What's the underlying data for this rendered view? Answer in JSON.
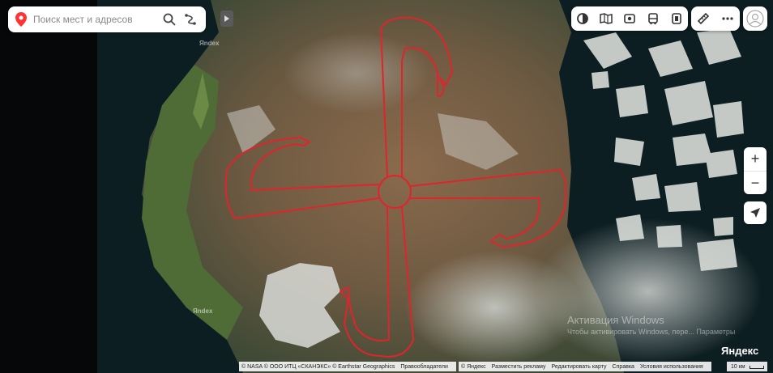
{
  "search": {
    "placeholder": "Поиск мест и адресов"
  },
  "icons": {
    "pin": "location-pin-icon",
    "search": "search-icon",
    "route": "route-icon",
    "collapse": "triangle-right-icon",
    "layers": "layers-icon",
    "panorama": "panorama-icon",
    "metro": "metro-icon",
    "transit": "bus-icon",
    "traffic": "traffic-icon",
    "ruler": "ruler-icon",
    "more": "more-icon",
    "user": "user-icon",
    "zoom_in": "plus-icon",
    "zoom_out": "minus-icon",
    "geolocation": "arrow-icon"
  },
  "map": {
    "watermarks": [
      "Яndex",
      "Яndex"
    ],
    "brand": "Яндекс",
    "overlay_text": [
      "Активация Windows",
      "Чтобы активировать Windows, пере... Параметры"
    ]
  },
  "zoom": {
    "in_label": "+",
    "out_label": "−"
  },
  "footer": {
    "left": [
      "© NASA © ООО ИТЦ «СКАНЭКС» © Earthstar Geographics",
      "Правообладатели"
    ],
    "right": [
      "© Яндекс",
      "Разместить рекламу",
      "Редактировать карту",
      "Справка",
      "Условия использования"
    ],
    "scale": "10 км"
  },
  "colors": {
    "drawing": "#e0242b",
    "ice": "#d8dcd8",
    "sea": "#0d1e22",
    "pin": "#f33"
  }
}
